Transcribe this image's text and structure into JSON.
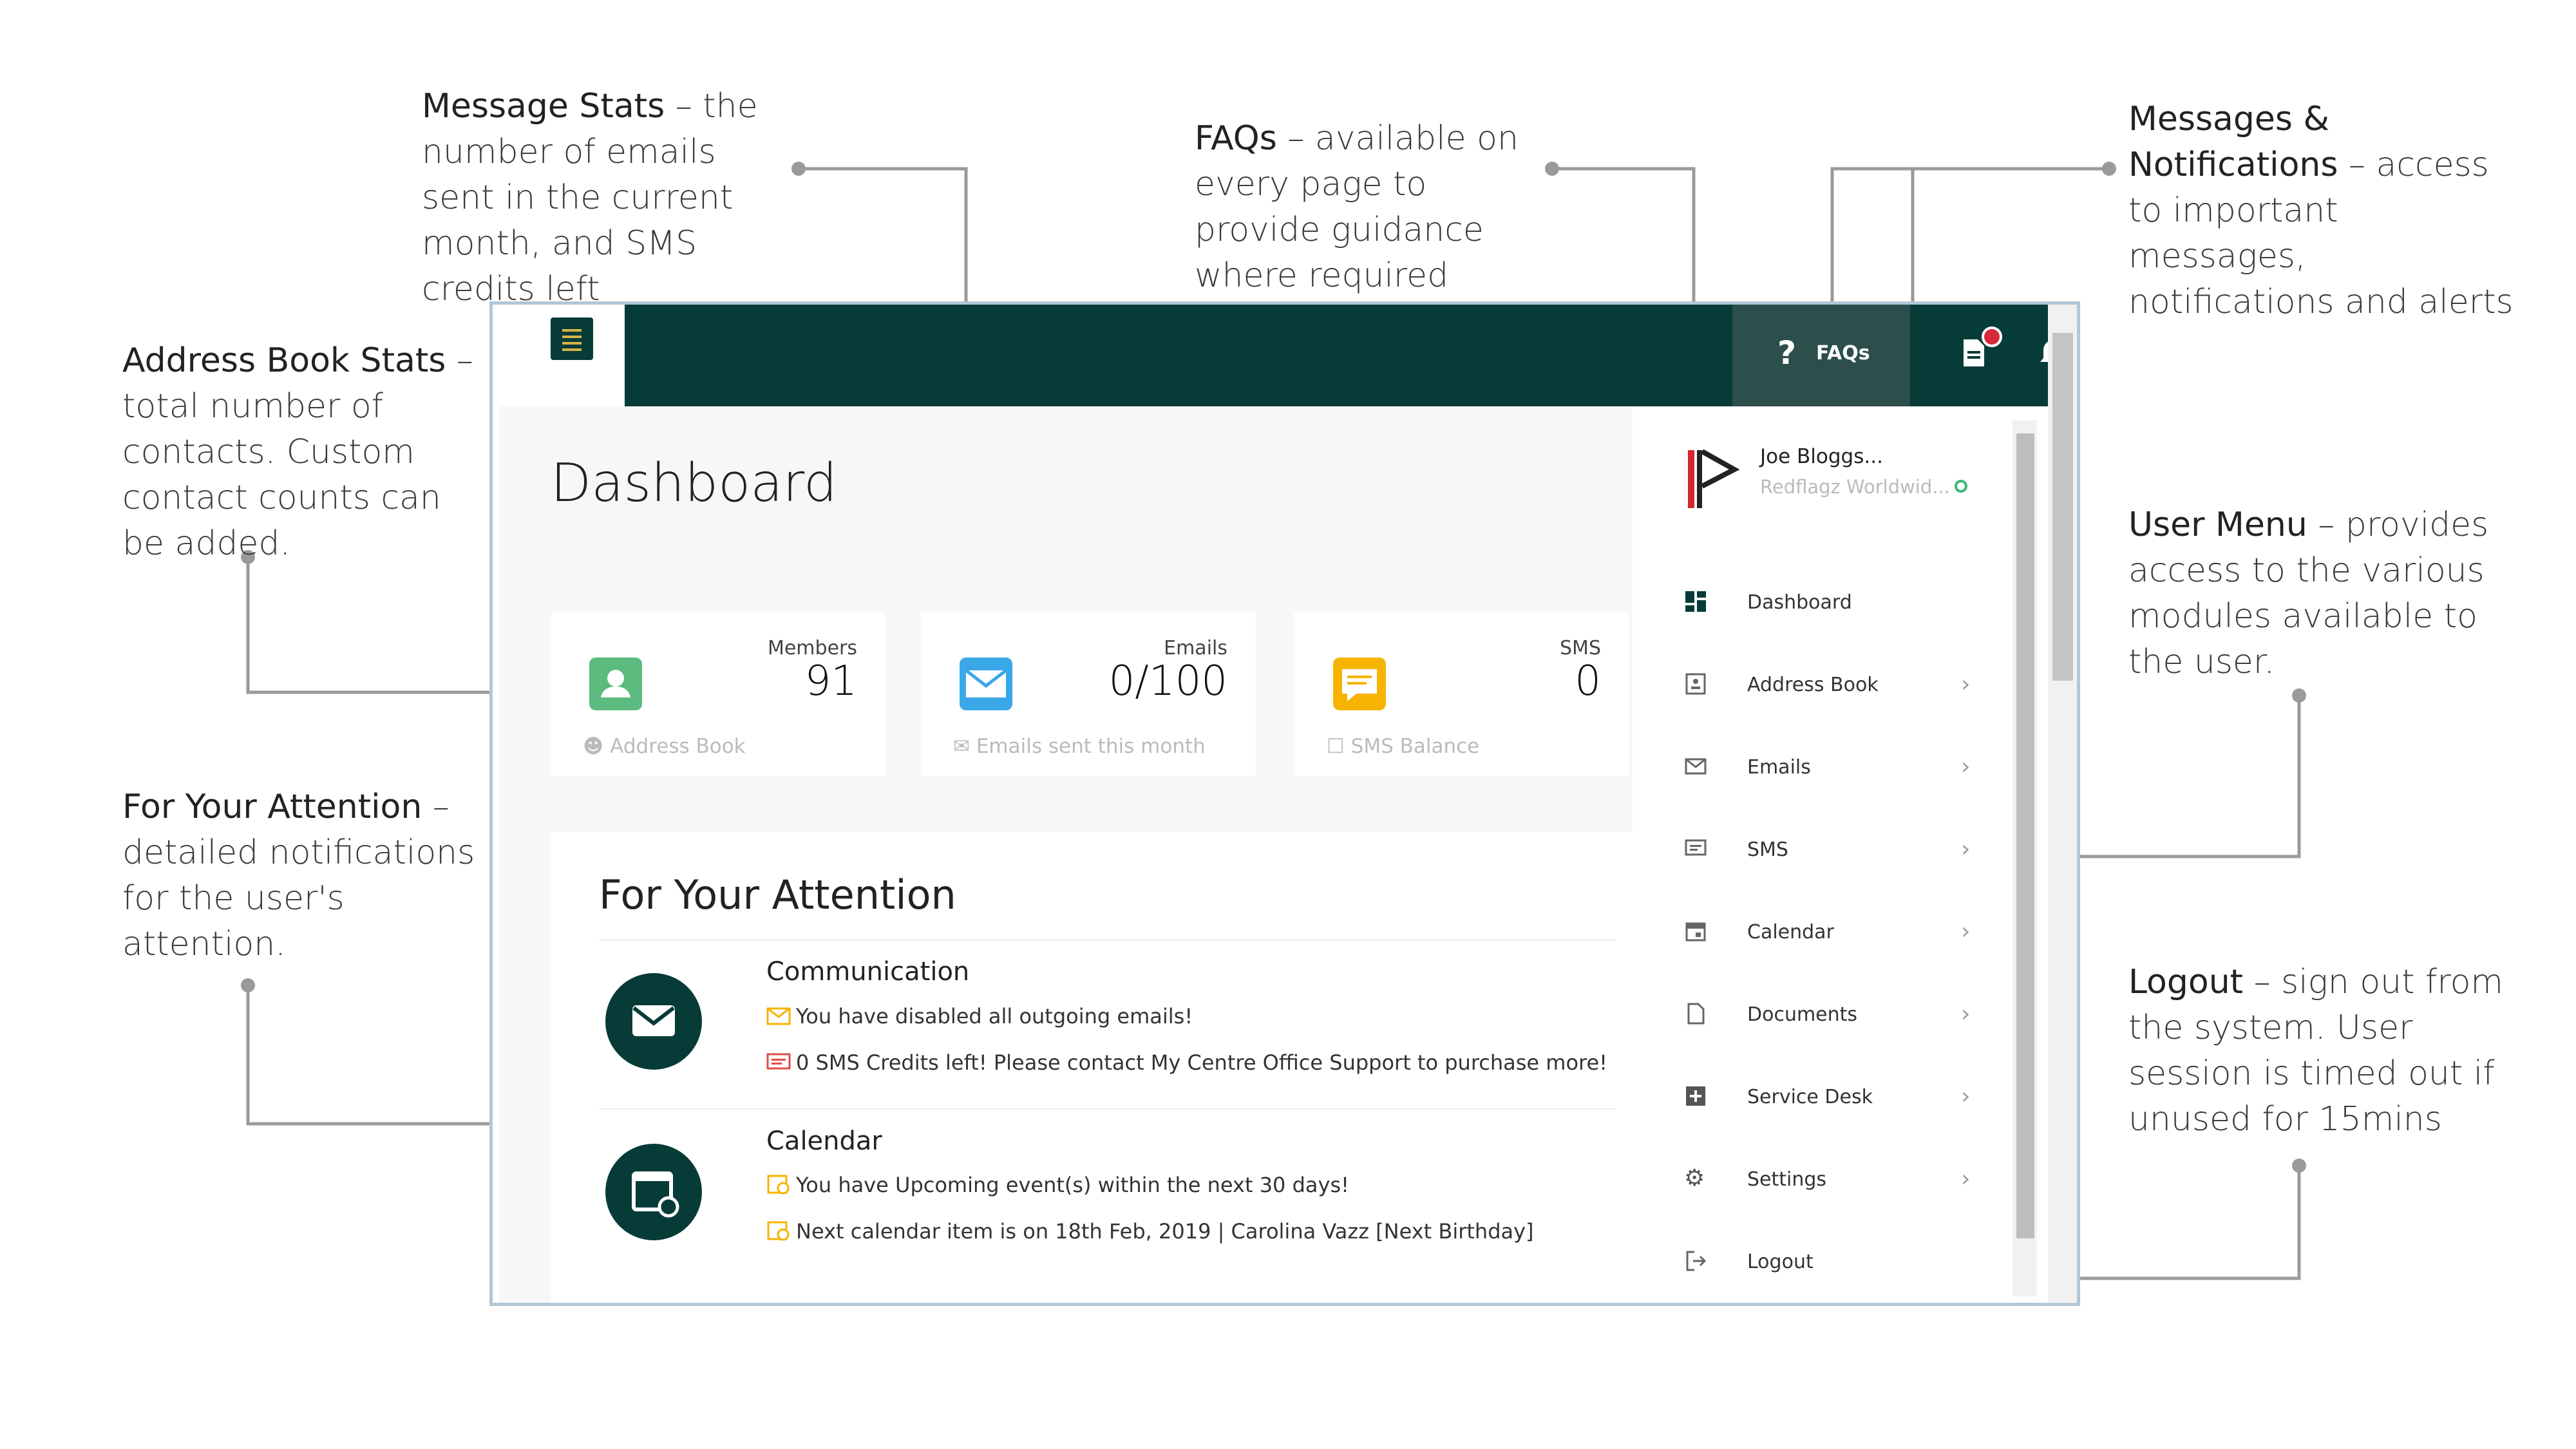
{
  "annotations": {
    "message_stats": {
      "title": "Message Stats",
      "text": "– the number of emails sent in the current month, and SMS credits left"
    },
    "faqs": {
      "title": "FAQs",
      "text": "– available on every page to provide guidance where required"
    },
    "messages": {
      "title": "Messages & Notifications",
      "text": "– access to important messages, notifications and alerts"
    },
    "address_book_stats": {
      "title": "Address Book Stats",
      "text": "– total number of contacts.  Custom contact counts can be added."
    },
    "user_menu": {
      "title": "User Menu",
      "text": "– provides access to the various modules available to the user."
    },
    "for_your_attention": {
      "title": "For Your Attention",
      "text": "– detailed notifications for the user's attention."
    },
    "logout": {
      "title": "Logout",
      "text": "– sign out from the system.  User session is timed out if unused for 15mins"
    }
  },
  "topbar": {
    "faq_label": "FAQs",
    "faq_icon": "question-icon",
    "docs_icon": "document-icon",
    "bell_icon": "bell-icon",
    "menu_icon": "hamburger-icon"
  },
  "dashboard": {
    "title": "Dashboard",
    "cards": [
      {
        "label": "Members",
        "value": "91",
        "footer": "Address Book",
        "icon": "contact-icon",
        "color": "#5cbb7e"
      },
      {
        "label": "Emails",
        "value": "0/100",
        "footer": "Emails sent this month",
        "icon": "envelope-icon",
        "color": "#3aa8e6"
      },
      {
        "label": "SMS",
        "value": "0",
        "footer": "SMS Balance",
        "icon": "chat-icon",
        "color": "#f6b400"
      }
    ]
  },
  "attention": {
    "title": "For Your Attention",
    "sections": [
      {
        "title": "Communication",
        "items": [
          "You have disabled all outgoing emails!",
          "0 SMS Credits left! Please contact My Centre Office Support to purchase more!"
        ]
      },
      {
        "title": "Calendar",
        "items": [
          "You have Upcoming event(s) within the next 30 days!",
          "Next calendar item is on 18th Feb, 2019 | Carolina Vazz [Next Birthday]"
        ]
      }
    ]
  },
  "user": {
    "name": "Joe Bloggs...",
    "org": "Redflagz Worldwid..."
  },
  "menu": [
    {
      "label": "Dashboard",
      "icon": "grid-icon"
    },
    {
      "label": "Address Book",
      "icon": "contact-book-icon"
    },
    {
      "label": "Emails",
      "icon": "envelope-icon"
    },
    {
      "label": "SMS",
      "icon": "chat-icon"
    },
    {
      "label": "Calendar",
      "icon": "calendar-icon"
    },
    {
      "label": "Documents",
      "icon": "file-icon"
    },
    {
      "label": "Service Desk",
      "icon": "plus-box-icon"
    },
    {
      "label": "Settings",
      "icon": "gear-icon"
    },
    {
      "label": "Logout",
      "icon": "logout-icon"
    }
  ]
}
